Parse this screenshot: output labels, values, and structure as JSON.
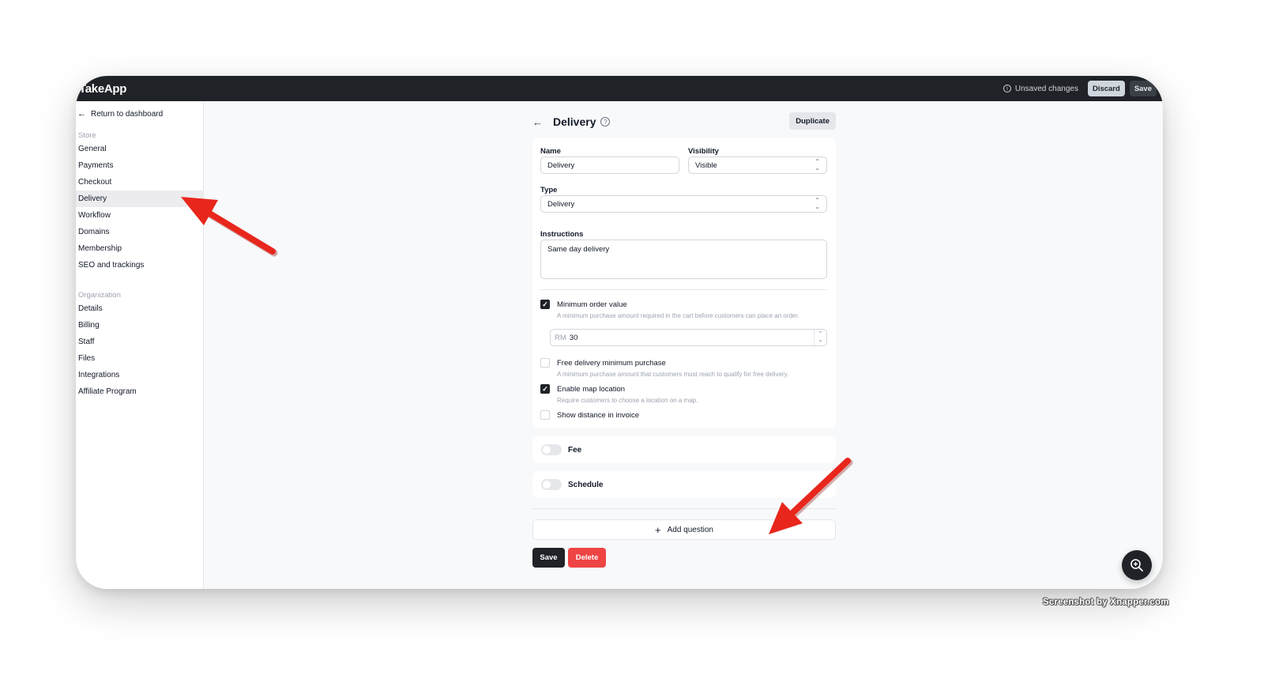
{
  "app": {
    "brand": "TakeApp"
  },
  "topbar": {
    "unsaved_label": "Unsaved changes",
    "discard_label": "Discard",
    "save_label": "Save"
  },
  "sidebar": {
    "return_label": "Return to dashboard",
    "store_label": "Store",
    "store_items": [
      {
        "label": "General"
      },
      {
        "label": "Payments"
      },
      {
        "label": "Checkout"
      },
      {
        "label": "Delivery",
        "active": true
      },
      {
        "label": "Workflow"
      },
      {
        "label": "Domains"
      },
      {
        "label": "Membership"
      },
      {
        "label": "SEO and trackings"
      }
    ],
    "org_label": "Organization",
    "org_items": [
      {
        "label": "Details"
      },
      {
        "label": "Billing"
      },
      {
        "label": "Staff"
      },
      {
        "label": "Files"
      },
      {
        "label": "Integrations"
      },
      {
        "label": "Affiliate Program"
      }
    ]
  },
  "page": {
    "title": "Delivery",
    "duplicate_label": "Duplicate"
  },
  "form": {
    "name_label": "Name",
    "name_value": "Delivery",
    "visibility_label": "Visibility",
    "visibility_value": "Visible",
    "type_label": "Type",
    "type_value": "Delivery",
    "instructions_label": "Instructions",
    "instructions_value": "Same day delivery",
    "min_order": {
      "label": "Minimum order value",
      "desc": "A minimum purchase amount required in the cart before customers can place an order.",
      "checked": true,
      "currency": "RM",
      "value": "30"
    },
    "free_delivery": {
      "label": "Free delivery minimum purchase",
      "desc": "A minimum purchase amount that customers must reach to qualify for free delivery.",
      "checked": false
    },
    "map_location": {
      "label": "Enable map location",
      "desc": "Require customers to choose a location on a map.",
      "checked": true
    },
    "show_distance": {
      "label": "Show distance in invoice",
      "checked": false
    }
  },
  "fee": {
    "label": "Fee",
    "enabled": false
  },
  "schedule": {
    "label": "Schedule",
    "enabled": false
  },
  "add_question_label": "Add question",
  "actions": {
    "save_label": "Save",
    "delete_label": "Delete"
  },
  "watermark": "Screenshot by Xnapper.com",
  "colors": {
    "topbar": "#1f2227",
    "accent_dark": "#1f2227",
    "danger": "#ef4444",
    "annotation_arrow": "#e8261c"
  },
  "icons": [
    "info-icon",
    "back-arrow-icon",
    "help-icon",
    "chevron-updown-icon",
    "check-icon",
    "plus-icon",
    "zoom-in-icon"
  ]
}
